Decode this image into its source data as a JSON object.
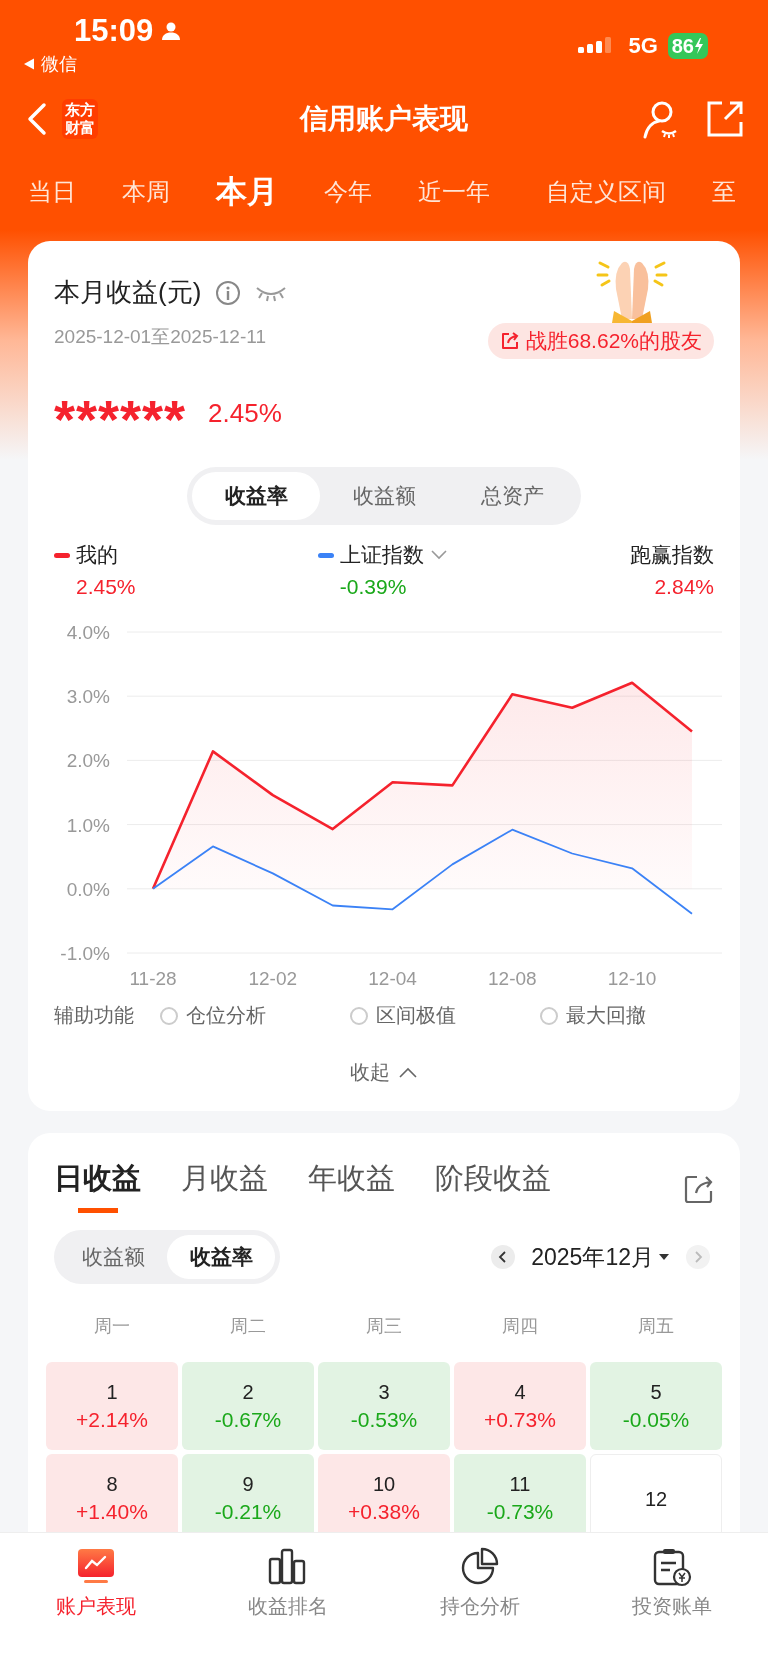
{
  "status_bar": {
    "time": "15:09",
    "back_app": "微信",
    "network": "5G",
    "battery": "86"
  },
  "nav": {
    "logo_lines": [
      "东方",
      "财富"
    ],
    "title": "信用账户表现"
  },
  "period_tabs": [
    {
      "label": "当日",
      "selected": false
    },
    {
      "label": "本周",
      "selected": false
    },
    {
      "label": "本月",
      "selected": true
    },
    {
      "label": "今年",
      "selected": false
    },
    {
      "label": "近一年",
      "selected": false
    },
    {
      "label": "自定义区间",
      "selected": false
    },
    {
      "label": "至",
      "selected": false
    }
  ],
  "summary_card": {
    "title": "本月收益(元)",
    "date_range": "2025-12-01至2025-12-11",
    "beat_badge": "战胜68.62%的股友",
    "amount": "******",
    "rate": "2.45%",
    "metric_tabs": [
      {
        "label": "收益率",
        "selected": true
      },
      {
        "label": "收益额",
        "selected": false
      },
      {
        "label": "总资产",
        "selected": false
      }
    ],
    "legend": [
      {
        "name": "我的",
        "value": "2.45%",
        "kind": "gain",
        "color": "#f5222d"
      },
      {
        "name": "上证指数",
        "value": "-0.39%",
        "kind": "loss",
        "color": "#3b82f6",
        "dropdown": true
      },
      {
        "name": "跑赢指数",
        "value": "2.84%",
        "kind": "gain"
      }
    ],
    "chart_data": {
      "type": "line",
      "grid": true,
      "categories": [
        "11-28",
        null,
        "12-02",
        null,
        "12-04",
        null,
        "12-08",
        null,
        "12-10",
        null
      ],
      "ylim": [
        -1,
        4
      ],
      "yticks": [
        {
          "value": 4,
          "label": "4.0%"
        },
        {
          "value": 3,
          "label": "3.0%"
        },
        {
          "value": 2,
          "label": "2.0%"
        },
        {
          "value": 1,
          "label": "1.0%"
        },
        {
          "value": 0,
          "label": "0.0%"
        },
        {
          "value": -1,
          "label": "-1.0%"
        }
      ],
      "series": [
        {
          "type": "area",
          "color": "#f5222d",
          "values": [
            0,
            2.14,
            1.46,
            0.93,
            1.66,
            1.61,
            3.03,
            2.82,
            3.21,
            2.45
          ]
        },
        {
          "type": "line",
          "color": "#3b82f6",
          "values": [
            0,
            0.66,
            0.24,
            -0.26,
            -0.32,
            0.38,
            0.92,
            0.55,
            0.32,
            -0.39
          ]
        }
      ]
    },
    "aux": {
      "label": "辅助功能",
      "options": [
        {
          "label": "仓位分析",
          "checked": false
        },
        {
          "label": "区间极值",
          "checked": false
        },
        {
          "label": "最大回撤",
          "checked": false
        }
      ]
    },
    "collapse": "收起"
  },
  "returns_card": {
    "tabs": [
      {
        "label": "日收益",
        "selected": true
      },
      {
        "label": "月收益",
        "selected": false
      },
      {
        "label": "年收益",
        "selected": false
      },
      {
        "label": "阶段收益",
        "selected": false
      }
    ],
    "toggle": [
      {
        "label": "收益额",
        "selected": false
      },
      {
        "label": "收益率",
        "selected": true
      }
    ],
    "month": "2025年12月",
    "weekdays": [
      "周一",
      "周二",
      "周三",
      "周四",
      "周五"
    ],
    "days": [
      {
        "day": "1",
        "change": "+2.14%",
        "kind": "gain"
      },
      {
        "day": "2",
        "change": "-0.67%",
        "kind": "loss"
      },
      {
        "day": "3",
        "change": "-0.53%",
        "kind": "loss"
      },
      {
        "day": "4",
        "change": "+0.73%",
        "kind": "gain"
      },
      {
        "day": "5",
        "change": "-0.05%",
        "kind": "loss"
      },
      {
        "day": "8",
        "change": "+1.40%",
        "kind": "gain"
      },
      {
        "day": "9",
        "change": "-0.21%",
        "kind": "loss"
      },
      {
        "day": "10",
        "change": "+0.38%",
        "kind": "gain"
      },
      {
        "day": "11",
        "change": "-0.73%",
        "kind": "loss"
      },
      {
        "day": "12",
        "kind": "open"
      }
    ]
  },
  "tab_bar": [
    {
      "label": "账户表现",
      "selected": true
    },
    {
      "label": "收益排名",
      "selected": false
    },
    {
      "label": "持仓分析",
      "selected": false
    },
    {
      "label": "投资账单",
      "selected": false
    }
  ]
}
